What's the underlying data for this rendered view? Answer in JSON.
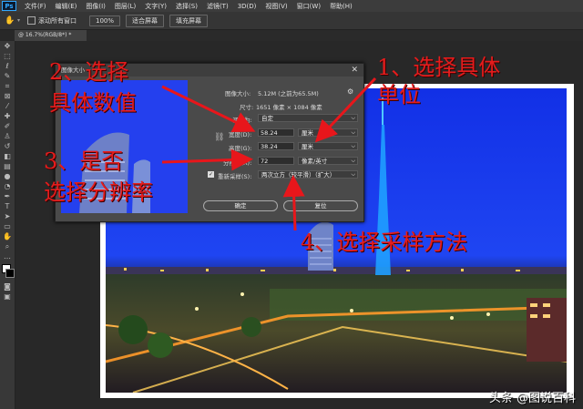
{
  "menubar": {
    "logo": "Ps",
    "items": [
      "文件(F)",
      "编辑(E)",
      "图像(I)",
      "图层(L)",
      "文字(Y)",
      "选择(S)",
      "滤镜(T)",
      "3D(D)",
      "视图(V)",
      "窗口(W)",
      "帮助(H)"
    ]
  },
  "options": {
    "scroll_all_label": "滚动所有窗口",
    "zoom_btn": "100%",
    "fit_btn": "适合屏幕",
    "fill_btn": "填充屏幕"
  },
  "tab": {
    "label": "@ 16.7%(RGB/8*) *"
  },
  "dialog": {
    "title": "图像大小",
    "image_size_label": "图像大小:",
    "image_size_value": "5.12M (之前为65.5M)",
    "dimensions_label": "尺寸:",
    "dimensions_value": "1651 像素 × 1084 像素",
    "fit_to_label": "调整为:",
    "fit_to_value": "自定",
    "width_label": "宽度(D):",
    "width_value": "58.24",
    "width_unit": "厘米",
    "height_label": "高度(G):",
    "height_value": "38.24",
    "height_unit": "厘米",
    "resolution_label": "分辨率(R):",
    "resolution_value": "72",
    "resolution_unit": "像素/英寸",
    "resample_label": "重新采样(S):",
    "resample_value": "两次立方（较平滑）（扩大）",
    "ok_label": "确定",
    "cancel_label": "复位"
  },
  "annotations": {
    "a1_line1": "1、选择具体",
    "a1_line2": "单位",
    "a2_line1": "2、选择",
    "a2_line2": "具体数值",
    "a3_line1": "3、是否",
    "a3_line2": "选择分辨率",
    "a4": "4、选择采样方法"
  },
  "watermark": "头条 @图说百科"
}
